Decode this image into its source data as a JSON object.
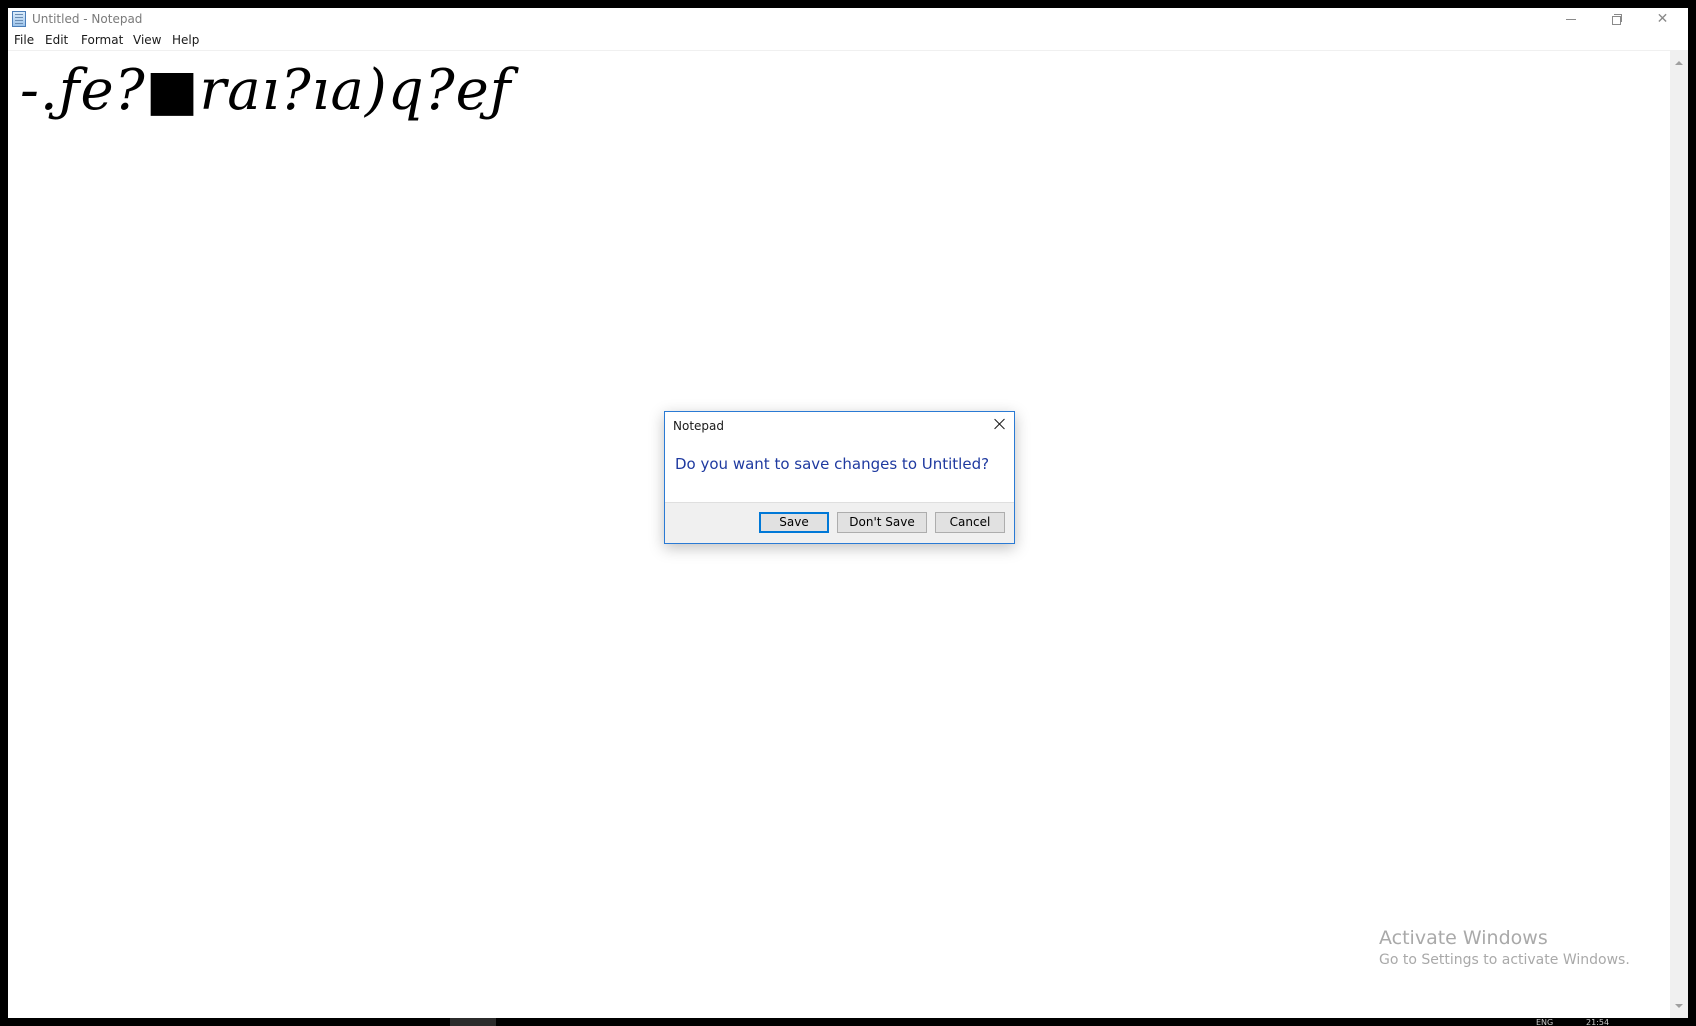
{
  "window": {
    "title": "Untitled - Notepad"
  },
  "menu": {
    "items": [
      "File",
      "Edit",
      "Format",
      "View",
      "Help"
    ]
  },
  "editor": {
    "content": "-.ƒe?■raı?ıa)q?eƒ"
  },
  "dialog": {
    "title": "Notepad",
    "message": "Do you want to save changes to Untitled?",
    "buttons": {
      "save": "Save",
      "dont_save": "Don't Save",
      "cancel": "Cancel"
    },
    "accent_color": "#0078d7"
  },
  "watermark": {
    "title": "Activate Windows",
    "subtitle": "Go to Settings to activate Windows."
  },
  "taskbar": {
    "tray_left": "ENG",
    "tray_time": "21:54"
  },
  "icons": {
    "app": "notepad-icon",
    "minimize": "minimize-icon",
    "maximize": "restore-icon",
    "close": "close-icon"
  }
}
